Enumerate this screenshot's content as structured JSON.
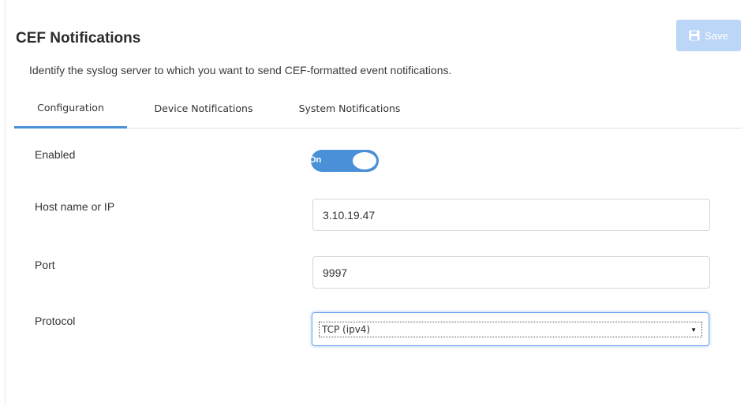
{
  "header": {
    "title": "CEF Notifications",
    "subtitle": "Identify the syslog server to which you want to send CEF-formatted event notifications.",
    "save_label": "Save",
    "save_icon": "floppy-disk-icon"
  },
  "tabs": [
    {
      "label": "Configuration",
      "active": true
    },
    {
      "label": "Device Notifications",
      "active": false
    },
    {
      "label": "System Notifications",
      "active": false
    }
  ],
  "form": {
    "enabled": {
      "label": "Enabled",
      "toggle_text": "On",
      "value": true
    },
    "host": {
      "label": "Host name or IP",
      "value": "3.10.19.47"
    },
    "port": {
      "label": "Port",
      "value": "9997"
    },
    "protocol": {
      "label": "Protocol",
      "value": "TCP (ipv4)"
    }
  },
  "colors": {
    "accent": "#4a90d9",
    "save_button_disabled": "#bcd6f7",
    "focus_ring": "#6ea6ef"
  }
}
